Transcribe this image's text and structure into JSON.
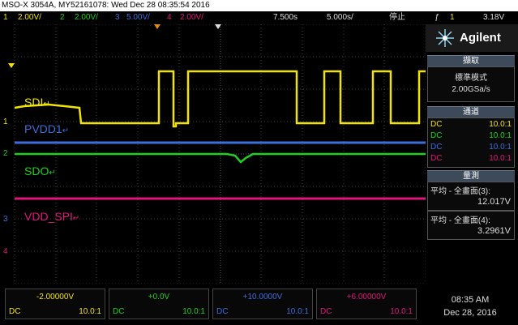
{
  "window": {
    "title": "MSO-X 3054A, MY52161078: Wed Dec 28 08:35:54 2016"
  },
  "status_bar": {
    "ch1": {
      "num": "1",
      "scale": "2.00V/"
    },
    "ch2": {
      "num": "2",
      "scale": "2.00V/"
    },
    "ch3": {
      "num": "3",
      "scale": "5.00V/"
    },
    "ch4": {
      "num": "4",
      "scale": "2.00V/"
    },
    "time_offset": "7.500s",
    "time_scale": "5.000s/",
    "run_state": "停止",
    "trigger_icon": "trigger-edge-icon",
    "trigger_symbol": "ƒ",
    "trigger_ch": "1",
    "trigger_level": "3.18V"
  },
  "traces": {
    "sdi": "SDI",
    "pvdd1": "PVDD1",
    "sdo": "SDO",
    "vdd_spi": "VDD_SPI",
    "mark": "↵",
    "gnd1": "1",
    "gnd2": "2",
    "gnd3": "3",
    "gnd4": "4"
  },
  "colors": {
    "ch1": "#f2e400",
    "ch2": "#1ed11e",
    "ch3": "#3c6edc",
    "ch4": "#e0177a"
  },
  "side_panel": {
    "brand": "Agilent",
    "acquire": {
      "header": "擷取",
      "mode": "標準模式",
      "rate": "2.00GSa/s"
    },
    "channels": {
      "header": "通道",
      "rows": [
        {
          "coupling": "DC",
          "probe": "10.0:1"
        },
        {
          "coupling": "DC",
          "probe": "10.0:1"
        },
        {
          "coupling": "DC",
          "probe": "10.0:1"
        },
        {
          "coupling": "DC",
          "probe": "10.0:1"
        }
      ]
    },
    "measure": {
      "header": "量測",
      "items": [
        {
          "label": "平均 - 全畫面(3):",
          "value": "12.017V"
        },
        {
          "label": "平均 - 全畫面(4):",
          "value": "3.2961V"
        }
      ]
    }
  },
  "bottom": {
    "channels": [
      {
        "offset": "-2.00000V",
        "coupling": "DC",
        "probe": "10.0:1"
      },
      {
        "offset": "+0.0V",
        "coupling": "DC",
        "probe": "10.0:1"
      },
      {
        "offset": "+10.0000V",
        "coupling": "DC",
        "probe": "10.0:1"
      },
      {
        "offset": "+6.00000V",
        "coupling": "DC",
        "probe": "10.0:1"
      }
    ],
    "time": "08:35 AM",
    "date": "Dec 28, 2016"
  }
}
